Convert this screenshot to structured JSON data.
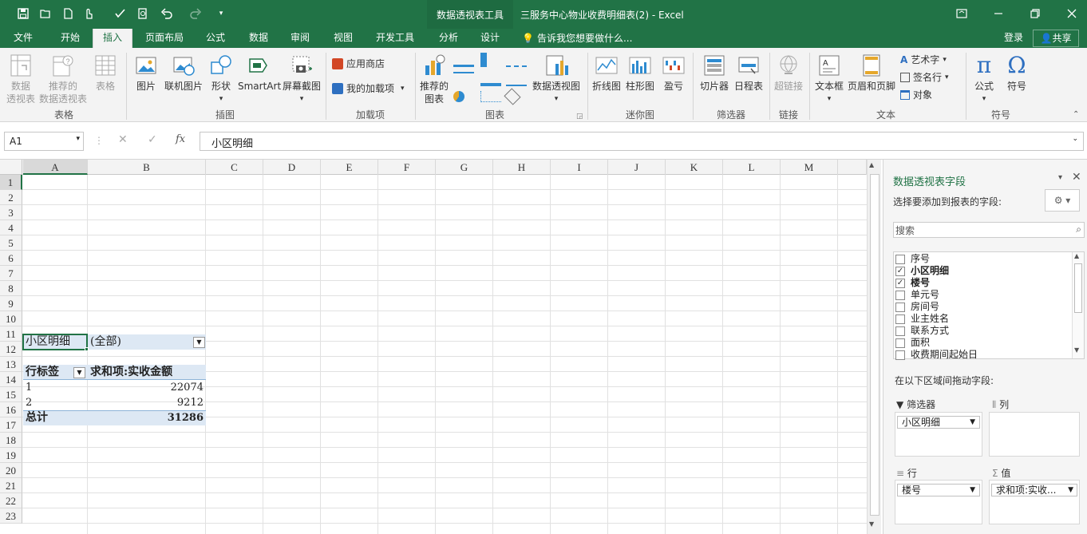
{
  "window": {
    "context_tools": "数据透视表工具",
    "title": "三服务中心物业收费明细表(2) - Excel"
  },
  "tabs": [
    "文件",
    "开始",
    "插入",
    "页面布局",
    "公式",
    "数据",
    "审阅",
    "视图",
    "开发工具",
    "分析",
    "设计"
  ],
  "tell_me": "告诉我您想要做什么...",
  "account": {
    "login": "登录",
    "share": "共享"
  },
  "ribbon": {
    "groups": {
      "tables": "表格",
      "illustrations": "插图",
      "addins": "加载项",
      "charts": "图表",
      "sparklines": "迷你图",
      "filters": "筛选器",
      "links": "链接",
      "text": "文本",
      "symbols": "符号"
    },
    "buttons": {
      "pivot_a": "数据",
      "pivot_b": "透视表",
      "rec_pivot_a": "推荐的",
      "rec_pivot_b": "数据透视表",
      "table": "表格",
      "picture": "图片",
      "online_picture": "联机图片",
      "shapes": "形状",
      "smartart": "SmartArt",
      "screenshot": "屏幕截图",
      "store": "应用商店",
      "my_addins": "我的加载项",
      "rec_charts_a": "推荐的",
      "rec_charts_b": "图表",
      "pivot_chart": "数据透视图",
      "line": "折线图",
      "column": "柱形图",
      "winloss": "盈亏",
      "slicer": "切片器",
      "timeline": "日程表",
      "hyperlink": "超链接",
      "textbox": "文本框",
      "header_footer": "页眉和页脚",
      "wordart": "艺术字",
      "signature": "签名行",
      "object": "对象",
      "equation": "公式",
      "symbol": "符号"
    }
  },
  "formula_bar": {
    "name_box": "A1",
    "content": "小区明细"
  },
  "columns": [
    "A",
    "B",
    "C",
    "D",
    "E",
    "F",
    "G",
    "H",
    "I",
    "J",
    "K",
    "L",
    "M"
  ],
  "rows": [
    "1",
    "2",
    "3",
    "4",
    "5",
    "6",
    "7",
    "8",
    "9",
    "10",
    "11",
    "12",
    "13",
    "14",
    "15",
    "16",
    "17",
    "18",
    "19",
    "20",
    "21",
    "22",
    "23"
  ],
  "pivot": {
    "filter_label": "小区明细",
    "filter_value": "(全部)",
    "row_header": "行标签",
    "value_header": "求和项:实收金额",
    "rows": [
      {
        "label": "1",
        "value": "22074"
      },
      {
        "label": "2",
        "value": "9212"
      }
    ],
    "total_label": "总计",
    "total_value": "31286"
  },
  "panel": {
    "title": "数据透视表字段",
    "choose_label": "选择要添加到报表的字段:",
    "search_placeholder": "搜索",
    "fields": [
      {
        "name": "序号",
        "checked": false
      },
      {
        "name": "小区明细",
        "checked": true
      },
      {
        "name": "楼号",
        "checked": true
      },
      {
        "name": "单元号",
        "checked": false
      },
      {
        "name": "房间号",
        "checked": false
      },
      {
        "name": "业主姓名",
        "checked": false
      },
      {
        "name": "联系方式",
        "checked": false
      },
      {
        "name": "面积",
        "checked": false
      },
      {
        "name": "收费期间起始日",
        "checked": false
      }
    ],
    "drag_label": "在以下区域间拖动字段:",
    "zones": {
      "filters": {
        "label": "筛选器",
        "item": "小区明细"
      },
      "columns": {
        "label": "列"
      },
      "rows": {
        "label": "行",
        "item": "楼号"
      },
      "values": {
        "label": "值",
        "item": "求和项:实收..."
      }
    }
  }
}
